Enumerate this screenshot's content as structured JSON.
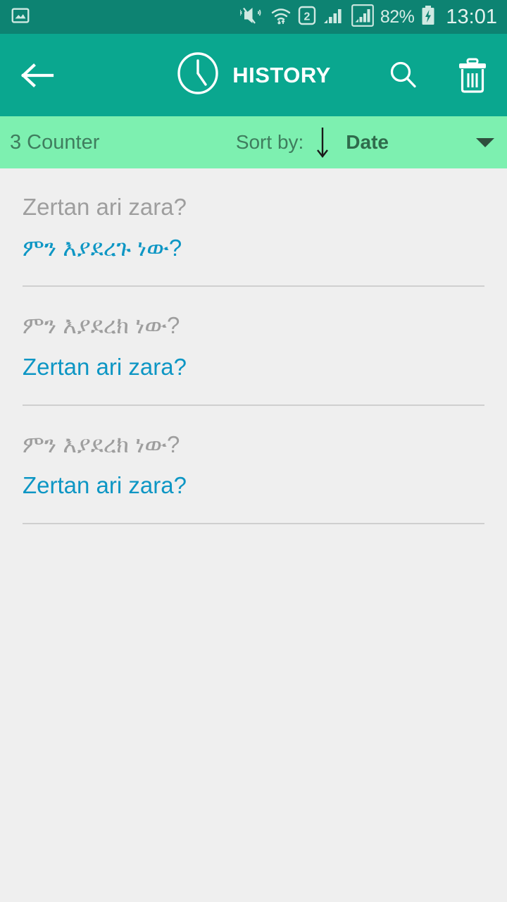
{
  "status_bar": {
    "icons": [
      "image-icon",
      "vibrate-mute-icon",
      "wifi-icon",
      "sim2-icon",
      "signal-bars-icon",
      "signal-bars-boxed-icon"
    ],
    "sim_label": "2",
    "battery_percent": "82%",
    "battery_state": "charging",
    "time": "13:01",
    "background": "#0d8372"
  },
  "app_bar": {
    "back_label": "back-arrow",
    "clock_icon": "clock-icon",
    "title": "HISTORY",
    "search_label": "search",
    "delete_label": "delete-all",
    "background": "#0aa78f",
    "text_color": "#ffffff"
  },
  "sort_bar": {
    "counter_text": "3 Counter",
    "sort_by_label": "Sort by:",
    "sort_direction": "descending",
    "sort_value": "Date",
    "sort_options": [
      "Date"
    ],
    "background": "#7df0b0",
    "text_color": "#3f7d5e"
  },
  "history": {
    "source_color": "#9e9e9e",
    "target_color": "#0d96c4",
    "items": [
      {
        "source_text": "Zertan ari zara?",
        "target_text": "ምን እያደረጉ ነው?"
      },
      {
        "source_text": "ምን እያደረክ ነው?",
        "target_text": "Zertan ari zara?"
      },
      {
        "source_text": "ምን እያደረክ ነው?",
        "target_text": "Zertan ari zara?"
      }
    ]
  }
}
